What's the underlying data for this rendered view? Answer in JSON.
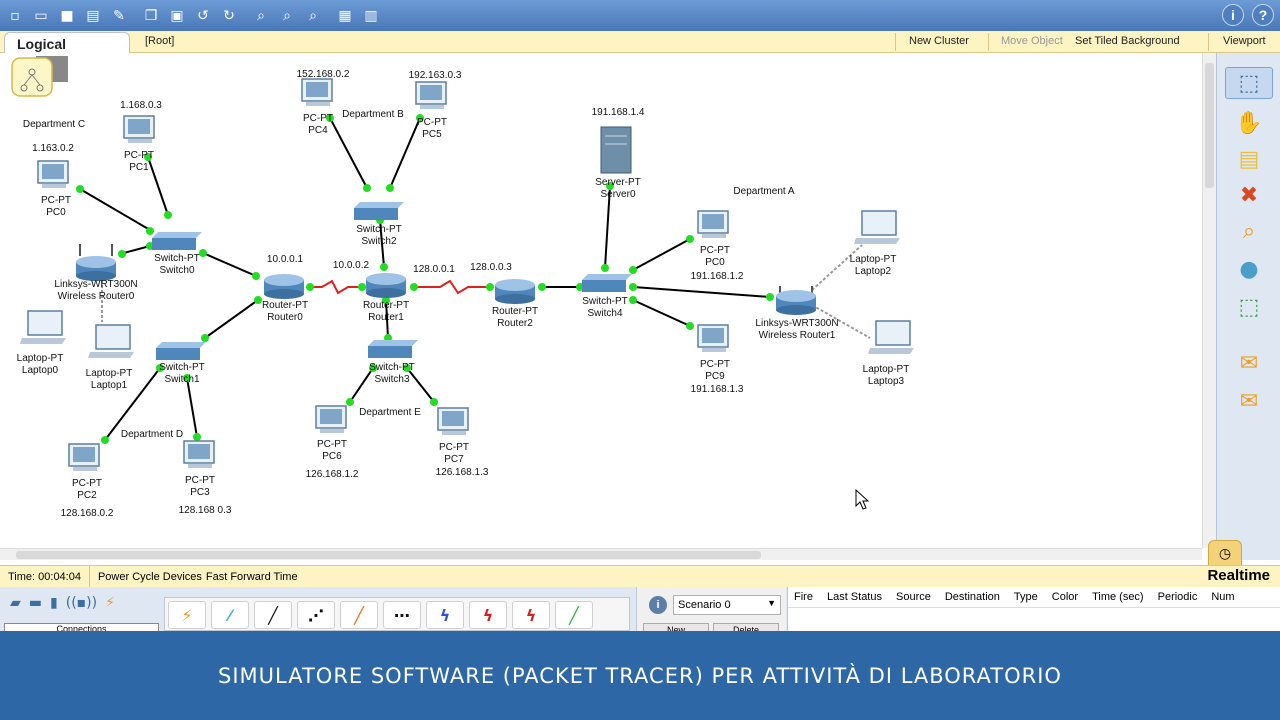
{
  "toolbar": {
    "left_icons": [
      "new-file-icon",
      "open-folder-icon",
      "save-icon",
      "print-icon",
      "activity-wizard-icon",
      "copy-icon",
      "paste-icon",
      "undo-icon",
      "redo-icon",
      "zoom-in-icon",
      "zoom-reset-icon",
      "zoom-out-icon",
      "palette-icon",
      "custom-device-icon"
    ],
    "info_label": "i",
    "help_label": "?"
  },
  "modebar": {
    "tab_label": "Logical",
    "path": "[Root]",
    "new_cluster": "New Cluster",
    "move_object": "Move Object",
    "set_tiled_background": "Set Tiled Background",
    "viewport": "Viewport"
  },
  "network": {
    "devices": [
      {
        "id": "pc1",
        "type": "pc",
        "line1": "PC-PT",
        "line2": "PC1",
        "ip": "1.168.0.3"
      },
      {
        "id": "pc0a",
        "type": "pc",
        "line1": "PC-PT",
        "line2": "PC0",
        "ip": "1.163.0.2"
      },
      {
        "id": "switch0",
        "type": "switch",
        "line1": "Switch-PT",
        "line2": "Switch0"
      },
      {
        "id": "wrouter0",
        "type": "wrouter",
        "line1": "Linksys-WRT300N",
        "line2": "Wireless Router0"
      },
      {
        "id": "laptop0",
        "type": "laptop",
        "line1": "Laptop-PT",
        "line2": "Laptop0"
      },
      {
        "id": "laptop1",
        "type": "laptop",
        "line1": "Laptop-PT",
        "line2": "Laptop1"
      },
      {
        "id": "switch1",
        "type": "switch",
        "line1": "Switch-PT",
        "line2": "Switch1"
      },
      {
        "id": "pc2",
        "type": "pc",
        "line1": "PC-PT",
        "line2": "PC2",
        "ip": "128.168.0.2"
      },
      {
        "id": "pc3",
        "type": "pc",
        "line1": "PC-PT",
        "line2": "PC3",
        "ip": "128.168 0.3"
      },
      {
        "id": "router0",
        "type": "router",
        "line1": "Router-PT",
        "line2": "Router0"
      },
      {
        "id": "pc4",
        "type": "pc",
        "line1": "PC-PT",
        "line2": "PC4",
        "ip": "152.168.0.2"
      },
      {
        "id": "pc5",
        "type": "pc",
        "line1": "PC-PT",
        "line2": "PC5",
        "ip": "192.163.0.3"
      },
      {
        "id": "switch2",
        "type": "switch",
        "line1": "Switch-PT",
        "line2": "Switch2"
      },
      {
        "id": "router1",
        "type": "router",
        "line1": "Router-PT",
        "line2": "Router1"
      },
      {
        "id": "switch3",
        "type": "switch",
        "line1": "Switch-PT",
        "line2": "Switch3"
      },
      {
        "id": "pc6",
        "type": "pc",
        "line1": "PC-PT",
        "line2": "PC6",
        "ip": "126.168.1.2"
      },
      {
        "id": "pc7",
        "type": "pc",
        "line1": "PC-PT",
        "line2": "PC7",
        "ip": "126.168.1.3"
      },
      {
        "id": "router2",
        "type": "router",
        "line1": "Router-PT",
        "line2": "Router2"
      },
      {
        "id": "server0",
        "type": "server",
        "line1": "Server-PT",
        "line2": "Server0",
        "ip": "191.168.1.4"
      },
      {
        "id": "switch4",
        "type": "switch",
        "line1": "Switch-PT",
        "line2": "Switch4"
      },
      {
        "id": "pc0b",
        "type": "pc",
        "line1": "PC-PT",
        "line2": "PC0",
        "ip": "191.168.1.2"
      },
      {
        "id": "pc9",
        "type": "pc",
        "line1": "PC-PT",
        "line2": "PC9",
        "ip": "191.168.1.3"
      },
      {
        "id": "wrouter1",
        "type": "wrouter",
        "line1": "Linksys-WRT300N",
        "line2": "Wireless Router1"
      },
      {
        "id": "laptop2",
        "type": "laptop",
        "line1": "Laptop-PT",
        "line2": "Laptop2"
      },
      {
        "id": "laptop3",
        "type": "laptop",
        "line1": "Laptop-PT",
        "line2": "Laptop3"
      }
    ],
    "departments": [
      "Department C",
      "Department B",
      "Department D",
      "Department E",
      "Department A"
    ],
    "link_addresses": [
      "10.0.0.1",
      "10.0.0.2",
      "128.0.0.1",
      "128.0.0.3"
    ],
    "colors": {
      "link": "#000000",
      "serial": "#e0201c",
      "port": "#22dd22",
      "wireless": "#999999"
    }
  },
  "right_panel": {
    "icons": [
      "select-icon",
      "move-hand-icon",
      "note-icon",
      "delete-icon",
      "inspect-icon",
      "draw-shape-icon",
      "resize-icon",
      "add-simple-pdu-icon",
      "add-complex-pdu-icon"
    ]
  },
  "statusbar": {
    "time": "Time: 00:04:04",
    "power_cycle": "Power Cycle Devices",
    "fast_forward": "Fast Forward Time",
    "mode": "Realtime"
  },
  "bottom": {
    "connections_label": "Connections",
    "connection_types": [
      "auto-connect",
      "console",
      "copper-straight",
      "copper-cross",
      "fiber",
      "phone",
      "coaxial",
      "serial-dce",
      "serial-dte",
      "octal"
    ],
    "scenario": "Scenario 0",
    "new_button": "New",
    "delete_button": "Delete",
    "pdu_columns": [
      "Fire",
      "Last Status",
      "Source",
      "Destination",
      "Type",
      "Color",
      "Time (sec)",
      "Periodic",
      "Num"
    ]
  },
  "banner": {
    "text": "SIMULATORE SOFTWARE (PACKET TRACER) PER ATTIVITÀ DI LABORATORIO"
  }
}
